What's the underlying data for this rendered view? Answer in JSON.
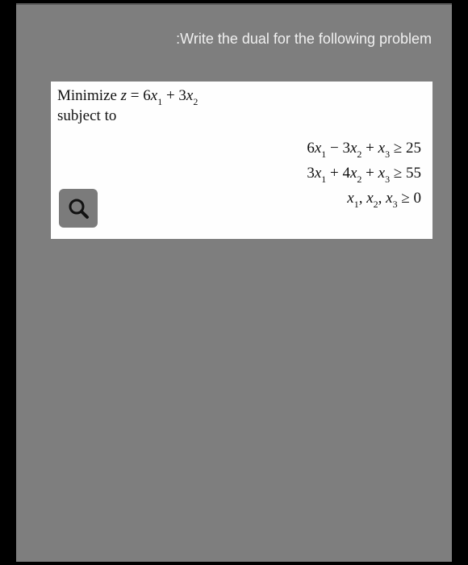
{
  "prompt": ":Write the dual for the following problem",
  "problem": {
    "objective_prefix": "Minimize ",
    "objective_expr_html": "<span class='it'>z</span> = 6<span class='it'>x</span><span class='sub'>1</span> + 3<span class='it'>x</span><span class='sub'>2</span>",
    "subject_to": "subject to",
    "constraints_html": [
      "6<span class='it'>x</span><span class='sub'>1</span> − 3<span class='it'>x</span><span class='sub'>2</span> + <span class='it'>x</span><span class='sub'>3</span> ≥ 25",
      "3<span class='it'>x</span><span class='sub'>1</span> + 4<span class='it'>x</span><span class='sub'>2</span> + <span class='it'>x</span><span class='sub'>3</span> ≥ 55",
      "<span class='it'>x</span><span class='sub'>1</span>, <span class='it'>x</span><span class='sub'>2</span>, <span class='it'>x</span><span class='sub'>3</span> ≥ 0"
    ]
  },
  "icons": {
    "magnifier": "magnifier-icon"
  },
  "colors": {
    "page_bg": "#7e7e7e",
    "box_bg": "#fefefe",
    "text_light": "#f0f0f0",
    "text_dark": "#111"
  }
}
